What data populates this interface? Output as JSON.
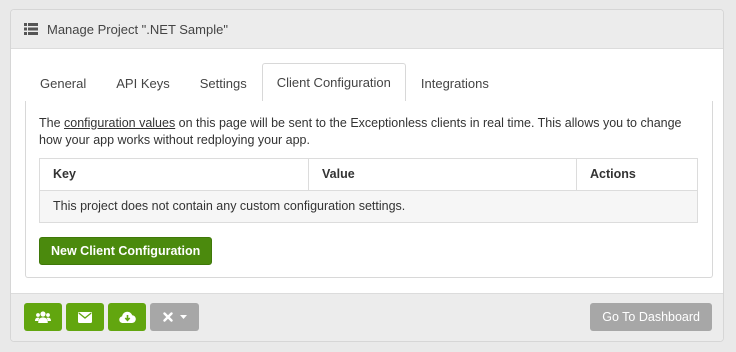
{
  "header": {
    "title": "Manage Project \".NET Sample\"",
    "icon": "list-icon"
  },
  "tabs": [
    {
      "label": "General",
      "active": false
    },
    {
      "label": "API Keys",
      "active": false
    },
    {
      "label": "Settings",
      "active": false
    },
    {
      "label": "Client Configuration",
      "active": true
    },
    {
      "label": "Integrations",
      "active": false
    }
  ],
  "client_config": {
    "description_prefix": "The ",
    "description_link": "configuration values",
    "description_suffix": " on this page will be sent to the Exceptionless clients in real time. This allows you to change how your app works without redploying your app.",
    "table": {
      "columns": [
        "Key",
        "Value",
        "Actions"
      ],
      "empty_message": "This project does not contain any custom configuration settings."
    },
    "new_button_label": "New Client Configuration"
  },
  "footer": {
    "buttons": [
      {
        "icon": "users-icon"
      },
      {
        "icon": "envelope-icon"
      },
      {
        "icon": "cloud-download-icon"
      },
      {
        "icon": "close-icon",
        "dropdown": true
      }
    ],
    "dashboard_label": "Go To Dashboard"
  },
  "colors": {
    "accent": "#62a60f",
    "primary_button": "#4b8a0d",
    "neutral_button": "#a7a7a7"
  }
}
